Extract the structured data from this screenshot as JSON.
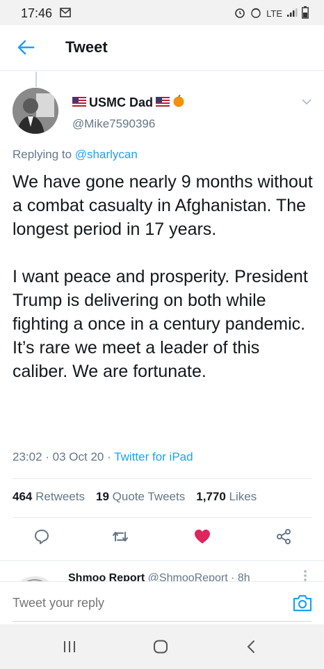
{
  "status_bar": {
    "time": "17:46",
    "network": "LTE"
  },
  "header": {
    "title": "Tweet"
  },
  "tweet": {
    "display_name": "USMC Dad",
    "handle": "@Mike7590396",
    "replying_label": "Replying to",
    "replying_to": "@sharlycan",
    "paragraphs": [
      "We have gone nearly 9 months without a combat casualty in Afghanistan. The longest period in 17 years.",
      "I want peace and prosperity. President Trump is delivering on both while fighting a once in a century pandemic. It’s rare we meet a leader of this caliber. We are fortunate."
    ],
    "timestamp": "23:02 · 03 Oct 20",
    "dot": "·",
    "source": "Twitter for iPad"
  },
  "stats": {
    "retweets_count": "464",
    "retweets_label": "Retweets",
    "quotes_count": "19",
    "quotes_label": "Quote Tweets",
    "likes_count": "1,770",
    "likes_label": "Likes"
  },
  "next_reply": {
    "name": "Shmoo Report",
    "handle_time": "@ShmooReport · 8h"
  },
  "reply_bar": {
    "placeholder": "Tweet your reply"
  },
  "colors": {
    "accent": "#1da1f2",
    "like": "#e0245e",
    "muted": "#657786"
  }
}
